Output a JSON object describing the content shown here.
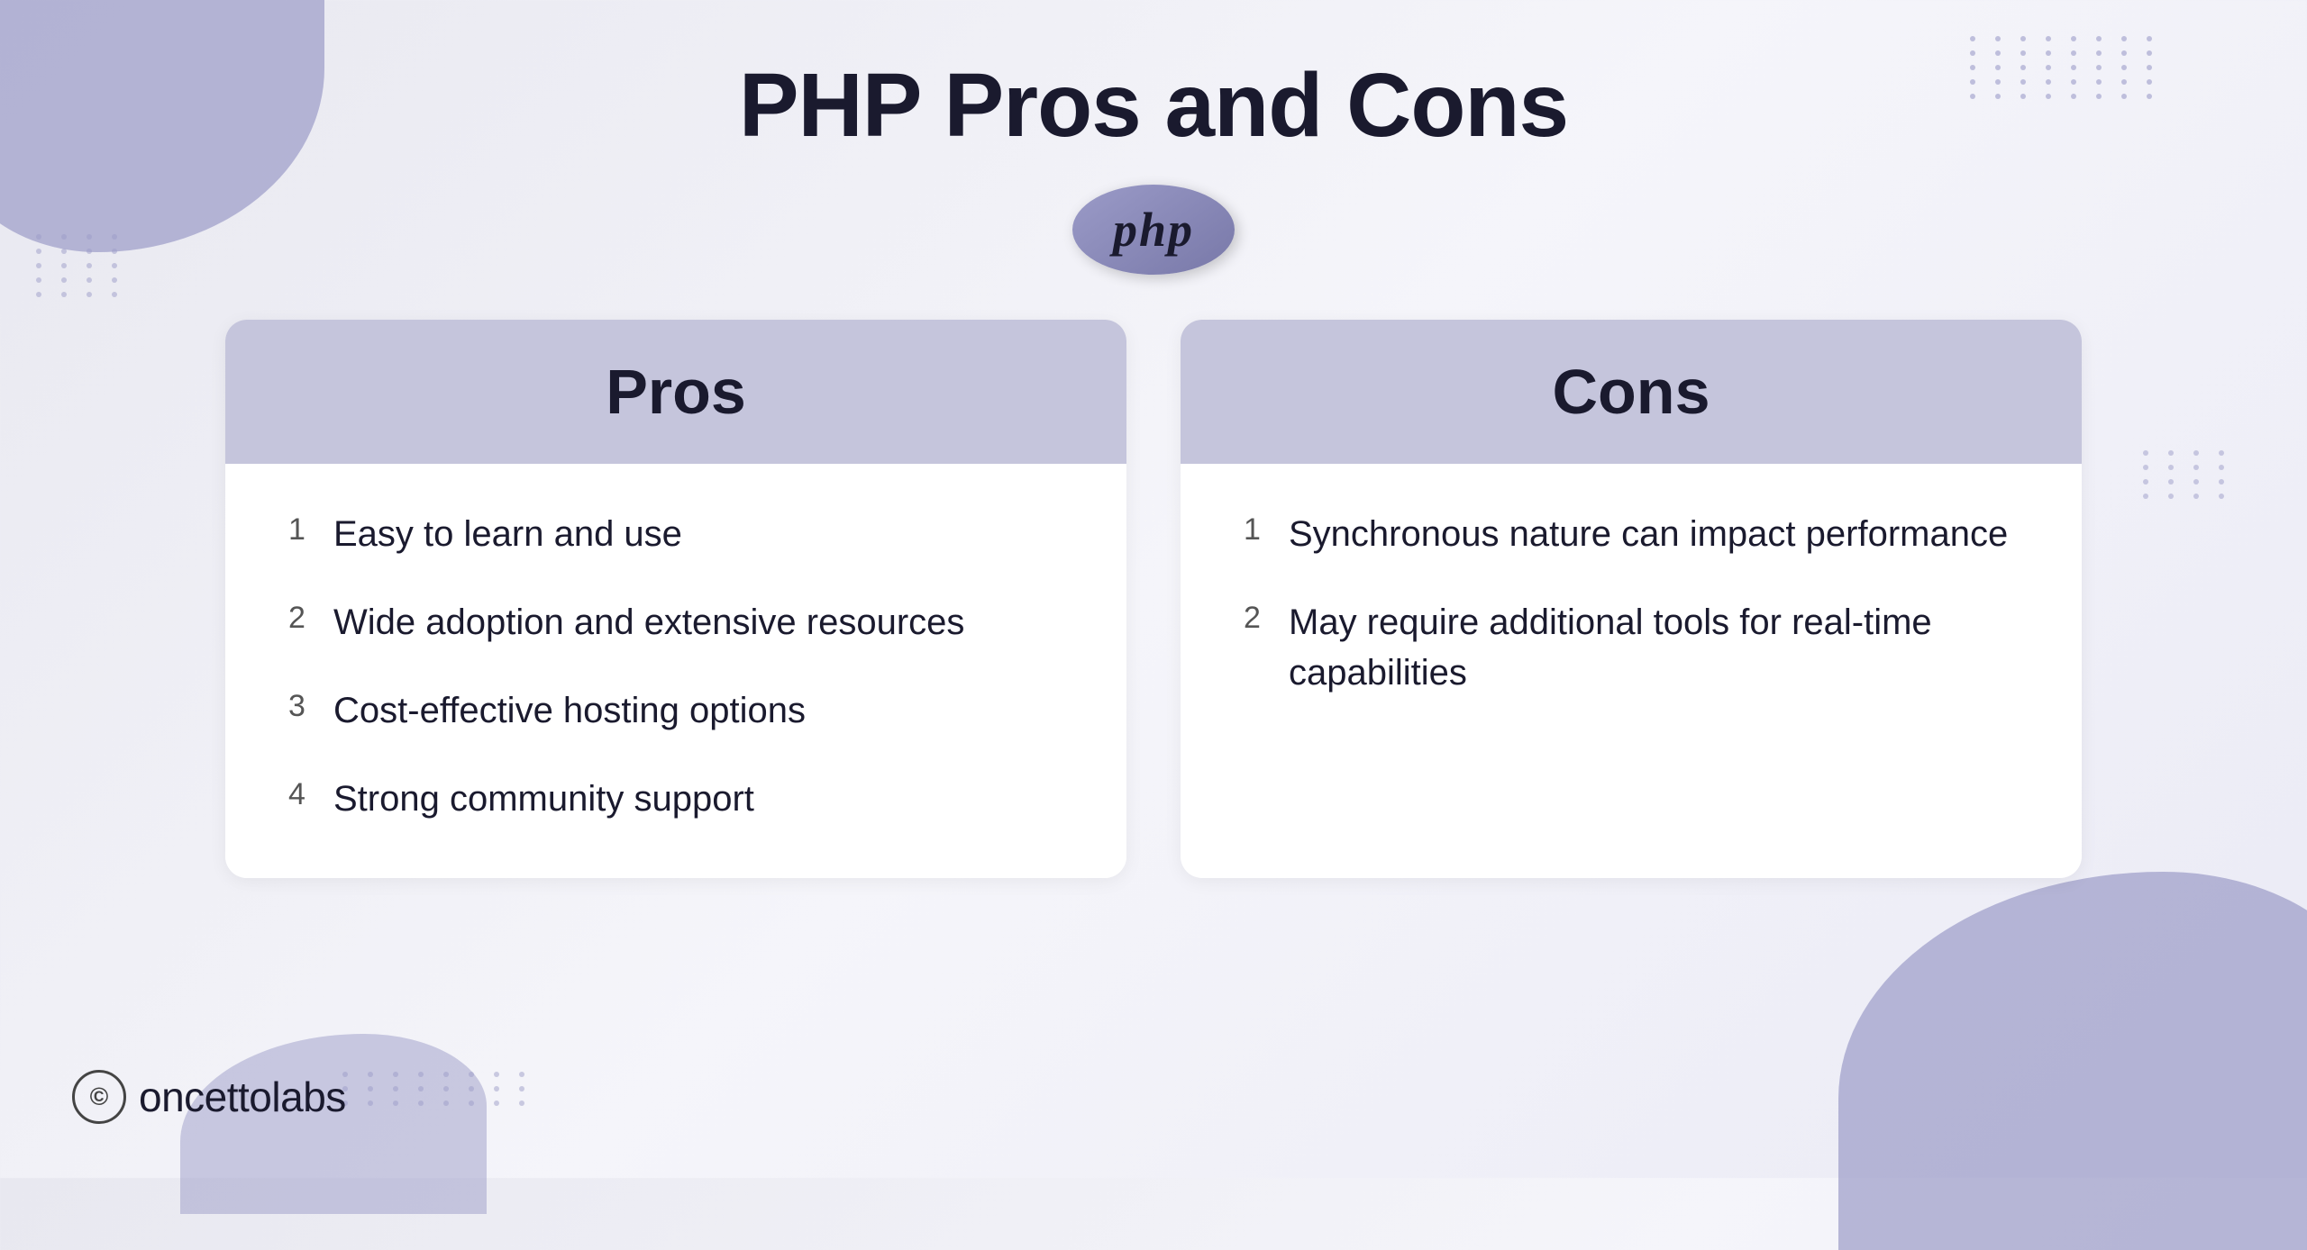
{
  "page": {
    "title": "PHP Pros and Cons",
    "background_color": "#f0f0f5"
  },
  "php_logo": {
    "text": "php"
  },
  "pros_card": {
    "header": "Pros",
    "items": [
      {
        "number": "1",
        "text": "Easy to learn and use"
      },
      {
        "number": "2",
        "text": "Wide adoption and extensive resources"
      },
      {
        "number": "3",
        "text": "Cost-effective hosting options"
      },
      {
        "number": "4",
        "text": "Strong community support"
      }
    ]
  },
  "cons_card": {
    "header": "Cons",
    "items": [
      {
        "number": "1",
        "text": "Synchronous nature can impact performance"
      },
      {
        "number": "2",
        "text": "May require additional tools for real-time capabilities"
      }
    ]
  },
  "brand": {
    "icon": "©",
    "name_bold": "oncetto",
    "name_light": "labs"
  },
  "dot_counts": {
    "top_right": 40,
    "left_mid": 20,
    "right_mid": 16,
    "bottom_center": 24
  }
}
